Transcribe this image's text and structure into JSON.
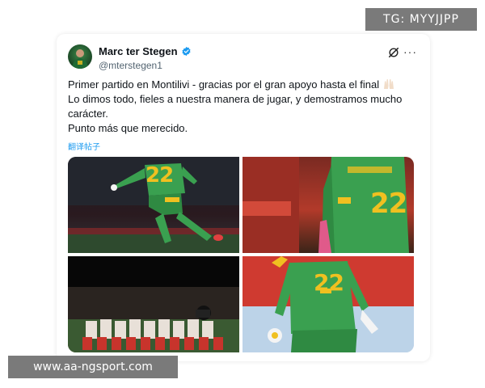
{
  "watermark": {
    "top_right": "TG: MYYJJPP",
    "bottom_left": "www.aa-ngsport.com"
  },
  "tweet": {
    "display_name": "Marc ter Stegen",
    "handle": "@mterstegen1",
    "verified": true,
    "icons": {
      "avatar": "player-avatar",
      "verified": "verified-badge-icon",
      "grok": "grok-icon",
      "more": "more-options-icon"
    },
    "more_label": "···",
    "text_lines": [
      "Primer partido en Montilivi - gracias por el gran apoyo hasta el final",
      "Lo dimos todo, fieles a nuestra manera de jugar, y demostramos mucho carácter.",
      "Punto más que merecido."
    ],
    "emoji": "raised-hands-emoji",
    "translate_label": "翻译帖子",
    "media": {
      "photos": [
        {
          "number": "22",
          "scene": "goalkeeper jumping"
        },
        {
          "number": "22",
          "scene": "goalkeeper back view"
        },
        {
          "number": "",
          "scene": "team lineup photo"
        },
        {
          "number": "22",
          "scene": "goalkeeper kneeling with ball"
        }
      ]
    }
  },
  "colors": {
    "accent": "#1d9bf0",
    "text": "#0f1419",
    "muted": "#536471",
    "jersey": "#3aa050",
    "number": "#f0c020"
  }
}
